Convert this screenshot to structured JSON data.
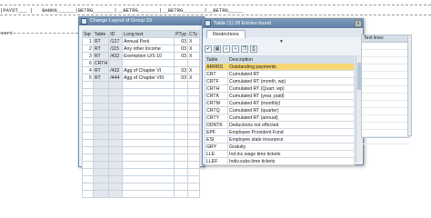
{
  "report": {
    "header_line": "|PAYDT___ |   BANKN______|BETRG_______|__BETRG_______|__BETRG_______|__BETRG_____",
    "side_label": "sort"
  },
  "window1": {
    "title": "Change Layout of Group 33",
    "columns": [
      "Sqr",
      "Table",
      "ID",
      "Long text",
      "PTyp",
      "CTy"
    ],
    "rows": [
      [
        "1",
        "RT",
        "/127",
        "Annual Perk",
        "03",
        "X"
      ],
      [
        "2",
        "RT",
        "/115",
        "Any other Income",
        "03",
        "X"
      ],
      [
        "3",
        "RT",
        "/432",
        "Exemption U/S 10",
        "03",
        "X"
      ],
      [
        "6",
        "CRTH",
        "",
        "",
        "",
        ""
      ],
      [
        "4",
        "RT",
        "/432",
        "Agg of Chapter VI",
        "03",
        "X"
      ],
      [
        "5",
        "RT",
        "/444",
        "Agg of Chapter VIII",
        "03",
        "X"
      ]
    ],
    "empty_rows": 16
  },
  "window2": {
    "title": "Table (1)  28 Entries found",
    "close_label": "x",
    "tab": "Restrictions",
    "chevron": "▼",
    "toolbar": [
      "check-icon",
      "table-icon",
      "find-icon",
      "find-next-icon",
      "copy-icon",
      "print-icon"
    ],
    "columns": [
      "Table",
      "Description"
    ],
    "rows": [
      [
        "ARRRS",
        "Outstanding payments"
      ],
      [
        "CRT",
        "Cumulated RT"
      ],
      [
        "CRTF",
        "Cumulated RT (month, wp)"
      ],
      [
        "CRTH",
        "Cumulated RT (Quart. wp)"
      ],
      [
        "CRTK",
        "Cumulated RT (year, paid)"
      ],
      [
        "CRTM",
        "Cumulated RT (monthly)"
      ],
      [
        "CRTQ",
        "Cumulated RT (quarter)"
      ],
      [
        "CRTY",
        "Cumulated RT (annual)"
      ],
      [
        "DDNTK",
        "Deductions not effected"
      ],
      [
        "EPF",
        "Employee Provident Fund"
      ],
      [
        "ESI",
        "Employee state insurance"
      ],
      [
        "GRY",
        "Gratuity"
      ],
      [
        "LLE",
        "Ind.inc.wage time tickets"
      ],
      [
        "LLEF",
        "Indiv.subs.time tickets"
      ]
    ],
    "highlight_color": "#f7d774"
  },
  "right_panel": {
    "header": "Text lines"
  }
}
